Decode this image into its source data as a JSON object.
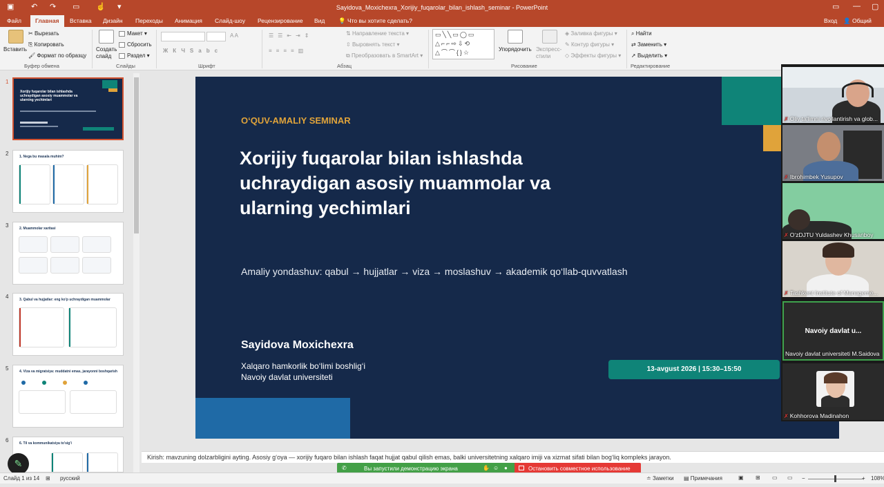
{
  "window": {
    "title": "Sayidova_Moxichexra_Xorijiy_fuqarolar_bilan_ishlash_seminar - PowerPoint",
    "sign_in": "Вход",
    "share": "Общий дост"
  },
  "tabs": [
    "Файл",
    "Главная",
    "Вставка",
    "Дизайн",
    "Переходы",
    "Анимация",
    "Слайд-шоу",
    "Рецензирование",
    "Вид"
  ],
  "tell_me": "Что вы хотите сделать?",
  "ribbon": {
    "paste": "Вставить",
    "cut": "Вырезать",
    "copy": "Копировать",
    "format_painter": "Формат по образцу",
    "clipboard_group": "Буфер обмена",
    "new_slide": "Создать слайд",
    "layout": "Макет",
    "reset": "Сбросить",
    "section": "Раздел",
    "slides_group": "Слайды",
    "font_group": "Шрифт",
    "text_direction": "Направление текста",
    "align_text": "Выровнять текст",
    "smartart": "Преобразовать в SmartArt",
    "paragraph_group": "Абзац",
    "arrange": "Упорядочить",
    "quick_styles": "Экспресс-стили",
    "shape_fill": "Заливка фигуры",
    "shape_outline": "Контур фигуры",
    "shape_effects": "Эффекты фигуры",
    "drawing_group": "Рисование",
    "find": "Найти",
    "replace": "Заменить",
    "select": "Выделить",
    "editing_group": "Редактирование"
  },
  "thumbnails": [
    {
      "num": "1",
      "title": "Xorijiy fuqarolar bilan ishlashda uchraydigan asosiy muammolar va ularning yechimlari"
    },
    {
      "num": "2",
      "title": "1. Nega bu masala muhim?"
    },
    {
      "num": "3",
      "title": "2. Muammolar xaritasi"
    },
    {
      "num": "4",
      "title": "3. Qabul va hujjatlar: eng ko'p uchraydigan muammolar"
    },
    {
      "num": "5",
      "title": "4. Viza va migratsiya: muddatni emas, jarayonni boshqarish"
    },
    {
      "num": "6",
      "title": "6. Til va kommunikatsiya to'sig'i"
    }
  ],
  "slide": {
    "kicker": "O‘QUV-AMALIY SEMINAR",
    "title": "Xorijiy fuqarolar bilan ishlashda uchraydigan asosiy muammolar va ularning yechimlari",
    "subtitle": "Amaliy yondashuv: qabul → hujjatlar → viza → moslashuv → akademik qo‘llab-quvvatlash",
    "author": "Sayidova Moxichexra",
    "affiliation_1": "Xalqaro hamkorlik bo‘limi boshlig‘i",
    "affiliation_2": "Navoiy davlat universiteti",
    "date": "13-avgust 2026  |  15:30–15:50"
  },
  "notes": "Kirish: mavzuning dolzarbligini ayting. Asosiy g‘oya — xorijiy fuqaro bilan ishlash faqat hujjat qabul qilish emas, balki universitetning xalqaro imiji va xizmat sifati bilan bog‘liq kompleks jarayon.",
  "sharing": {
    "presenting": "Вы запустили демонстрацию экрана",
    "stop": "Остановить совместное использование"
  },
  "status": {
    "slide_of": "Слайд 1 из 14",
    "language": "русский",
    "notes": "Заметки",
    "comments": "Примечания",
    "zoom": "108%"
  },
  "participants": [
    "Oliy ta'limni rivojlantirish va glob...",
    "Ibrohimbek Yusupov",
    "O‘zDJTU Yuldashev Khusanboy",
    "Tashkent Institute of Manageme...",
    "Navoiy davlat universiteti M.Saidova",
    "Kohhorova Madinahon"
  ],
  "active_tile_label": "Navoiy davlat u...",
  "colors": {
    "ppt_accent": "#b7472a",
    "slide_bg": "#15294a",
    "teal": "#0f8478",
    "gold": "#e0a33a"
  }
}
